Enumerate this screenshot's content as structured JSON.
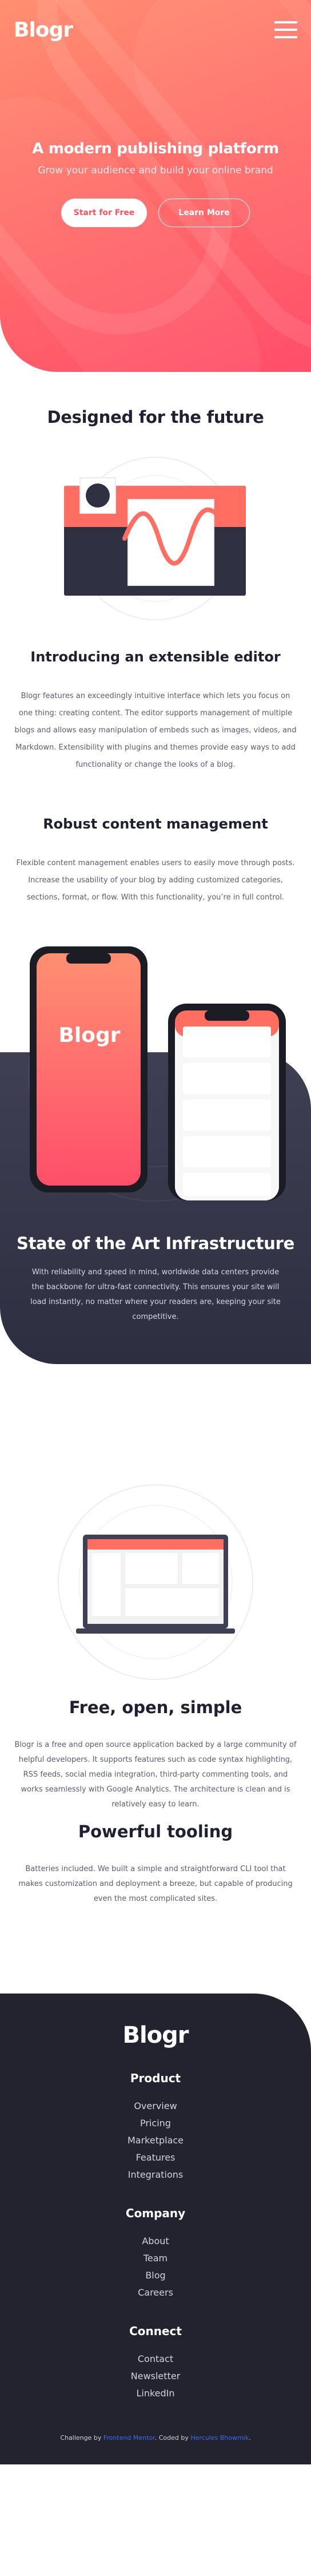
{
  "header": {
    "logo": "Blogr",
    "menu_icon": "hamburger-menu-icon"
  },
  "hero": {
    "title": "A modern publishing platform",
    "subtitle": "Grow your audience and build your online brand",
    "primary_button": "Start for Free",
    "secondary_button": "Learn More"
  },
  "design": {
    "title": "Designed for the future",
    "features": [
      {
        "title": "Introducing an extensible editor",
        "text": "Blogr features an exceedingly intuitive interface which lets you focus on one thing: creating content. The editor supports management of multiple blogs and allows easy manipulation of embeds such as images, videos, and Markdown. Extensibility with plugins and themes provide easy ways to add functionality or change the looks of a blog."
      },
      {
        "title": "Robust content management",
        "text": "Flexible content management enables users to easily move through posts. Increase the usability of your blog by adding customized categories, sections, format, or flow. With this functionality, you’re in full control."
      }
    ]
  },
  "infrastructure": {
    "phone_logo": "Blogr",
    "title": "State of the Art Infrastructure",
    "text": "With reliability and speed in mind, worldwide data centers provide the backbone for ultra-fast connectivity. This ensures your site will load instantly, no matter where your readers are, keeping your site competitive."
  },
  "features": [
    {
      "title": "Free, open, simple",
      "text": "Blogr is a free and open source application backed by a large community of helpful developers. It supports features such as code syntax highlighting, RSS feeds, social media integration, third-party commenting tools, and works seamlessly with Google Analytics. The architecture is clean and is relatively easy to learn."
    },
    {
      "title": "Powerful tooling",
      "text": "Batteries included. We built a simple and straightforward CLI tool that makes customization and deployment a breeze, but capable of producing even the most complicated sites."
    }
  ],
  "footer": {
    "logo": "Blogr",
    "columns": [
      {
        "heading": "Product",
        "links": [
          "Overview",
          "Pricing",
          "Marketplace",
          "Features",
          "Integrations"
        ]
      },
      {
        "heading": "Company",
        "links": [
          "About",
          "Team",
          "Blog",
          "Careers"
        ]
      },
      {
        "heading": "Connect",
        "links": [
          "Contact",
          "Newsletter",
          "LinkedIn"
        ]
      }
    ],
    "attribution": {
      "prefix": "Challenge by",
      "challenge_link": "Frontend Mentor",
      "middle": ". Coded by",
      "author_link": "Hercules Bhowmik",
      "suffix": "."
    }
  },
  "colors": {
    "hero_gradient_start": "#ff8f71",
    "hero_gradient_end": "#ff4e6a",
    "dark_blue": "#1f2132",
    "infra_bg": "#3f4053",
    "footer_bg": "#232330",
    "attribution_link": "#3d6de8"
  }
}
